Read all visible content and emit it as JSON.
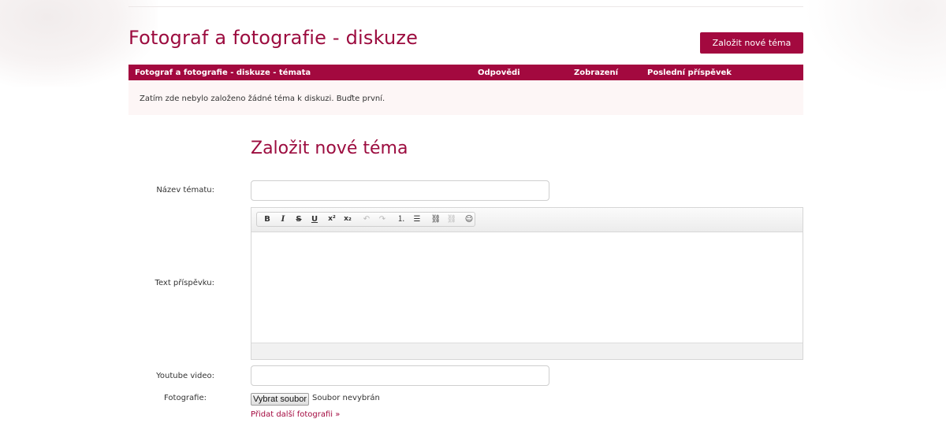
{
  "page": {
    "title": "Fotograf a fotografie - diskuze",
    "new_topic_button": "Založit nové téma"
  },
  "table": {
    "headers": {
      "topics": "Fotograf a fotografie - diskuze - témata",
      "replies": "Odpovědi",
      "views": "Zobrazení",
      "last_post": "Poslední příspěvek"
    },
    "empty_message": "Zatím zde nebylo založeno žádné téma k diskuzi. Buďte první."
  },
  "form": {
    "title": "Založit nové téma",
    "topic_name_label": "Název tématu:",
    "topic_name_value": "",
    "post_text_label": "Text příspěvku:",
    "youtube_label": "Youtube video:",
    "youtube_value": "",
    "photos_label": "Fotografie:",
    "file_button": "Vybrat soubor",
    "file_status": "Soubor nevybrán",
    "add_photo_link": "Přidat další fotografii »"
  },
  "editor_toolbar": {
    "buttons": [
      {
        "name": "bold-icon",
        "glyph": "B",
        "enabled": true
      },
      {
        "name": "italic-icon",
        "glyph": "I",
        "enabled": true
      },
      {
        "name": "strikethrough-icon",
        "glyph": "S",
        "enabled": true
      },
      {
        "name": "underline-icon",
        "glyph": "U",
        "enabled": true
      },
      {
        "name": "superscript-icon",
        "glyph": "x²",
        "enabled": true
      },
      {
        "name": "subscript-icon",
        "glyph": "x₂",
        "enabled": true
      },
      {
        "name": "undo-icon",
        "glyph": "↶",
        "enabled": false
      },
      {
        "name": "redo-icon",
        "glyph": "↷",
        "enabled": false
      },
      {
        "name": "numbered-list-icon",
        "glyph": "⒈",
        "enabled": true
      },
      {
        "name": "bulleted-list-icon",
        "glyph": "☰",
        "enabled": true
      },
      {
        "name": "link-icon",
        "glyph": "⛓",
        "enabled": true
      },
      {
        "name": "unlink-icon",
        "glyph": "⛓",
        "enabled": false
      },
      {
        "name": "smiley-icon",
        "glyph": "☺",
        "enabled": true
      }
    ]
  },
  "colors": {
    "accent": "#a3093f",
    "title": "#9c0c3f",
    "empty_row_bg": "#fdf6f6"
  }
}
